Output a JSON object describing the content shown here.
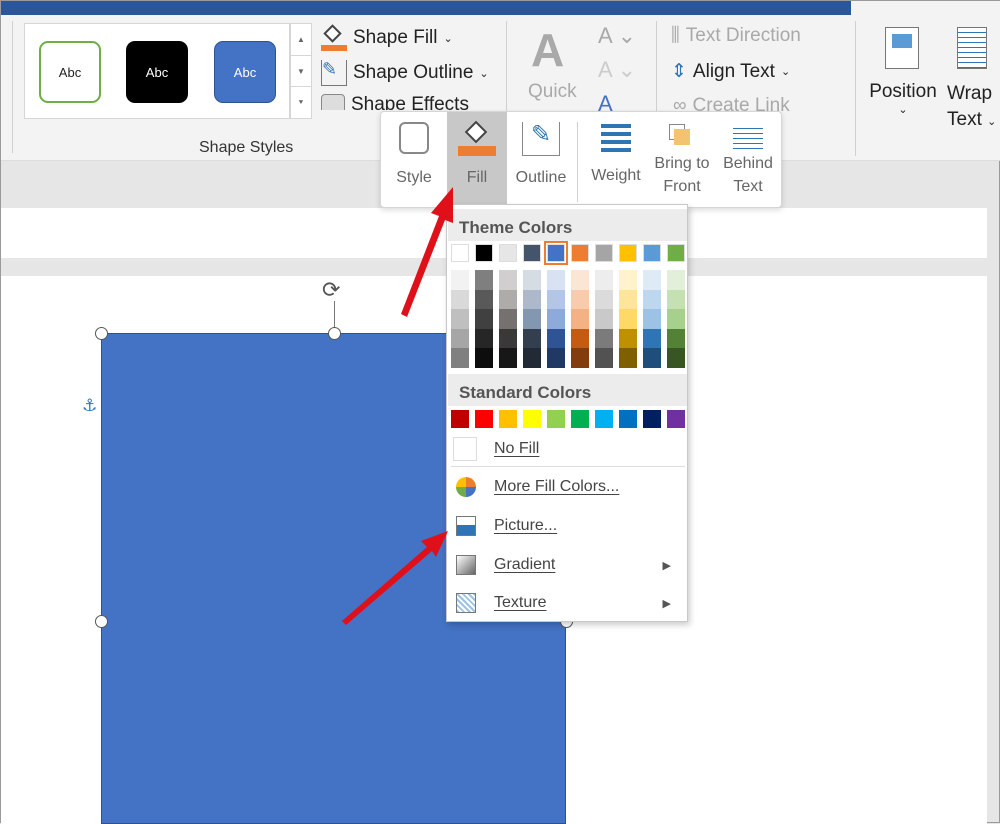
{
  "ribbon": {
    "style_samples": [
      "Abc",
      "Abc",
      "Abc"
    ],
    "shape_fill": "Shape Fill",
    "shape_outline": "Shape Outline",
    "shape_effects": "Shape Effects",
    "group_shape_styles": "Shape Styles",
    "quick": "Quick",
    "text_direction": "Text Direction",
    "align_text": "Align Text",
    "create_link": "Create Link",
    "position": "Position",
    "wrap": "Wrap",
    "wrap_text": "Text"
  },
  "mini_toolbar": {
    "style": "Style",
    "fill": "Fill",
    "outline": "Outline",
    "weight": "Weight",
    "bring1": "Bring to",
    "bring2": "Front",
    "behind1": "Behind",
    "behind2": "Text"
  },
  "fill_menu": {
    "theme_colors_label": "Theme Colors",
    "standard_colors_label": "Standard Colors",
    "theme_colors": [
      [
        "#ffffff",
        "#f2f2f2",
        "#d9d9d9",
        "#bfbfbf",
        "#a6a6a6",
        "#808080"
      ],
      [
        "#000000",
        "#7f7f7f",
        "#595959",
        "#404040",
        "#262626",
        "#0d0d0d"
      ],
      [
        "#e7e6e6",
        "#d0cece",
        "#aeabab",
        "#757171",
        "#3b3838",
        "#181717"
      ],
      [
        "#44546a",
        "#d6dce4",
        "#adb9ca",
        "#8497b0",
        "#333f4f",
        "#222a35"
      ],
      [
        "#4472c4",
        "#d9e2f3",
        "#b4c6e7",
        "#8eaadb",
        "#2f5496",
        "#1f3864"
      ],
      [
        "#ed7d31",
        "#fbe5d5",
        "#f7cbac",
        "#f4b183",
        "#c55a11",
        "#833c0b"
      ],
      [
        "#a5a5a5",
        "#ededed",
        "#dbdbdb",
        "#c9c9c9",
        "#7b7b7b",
        "#525252"
      ],
      [
        "#ffc000",
        "#fff2cc",
        "#fee599",
        "#ffd965",
        "#bf9000",
        "#7f6000"
      ],
      [
        "#5b9bd5",
        "#deebf6",
        "#bdd7ee",
        "#9cc3e5",
        "#2e75b5",
        "#1e4e79"
      ],
      [
        "#70ad47",
        "#e2efd9",
        "#c5e0b3",
        "#a8d08d",
        "#538135",
        "#375623"
      ]
    ],
    "selected_theme_color": "#4472c4",
    "standard_colors": [
      "#c00000",
      "#ff0000",
      "#ffc000",
      "#ffff00",
      "#92d050",
      "#00b050",
      "#00b0f0",
      "#0070c0",
      "#002060",
      "#7030a0"
    ],
    "no_fill": "No Fill",
    "more_fill_colors": "More Fill Colors...",
    "picture": "Picture...",
    "gradient": "Gradient",
    "texture": "Texture"
  },
  "colors": {
    "accent": "#2b579a",
    "shape": "#4472c4",
    "arrow": "#e0101a"
  }
}
